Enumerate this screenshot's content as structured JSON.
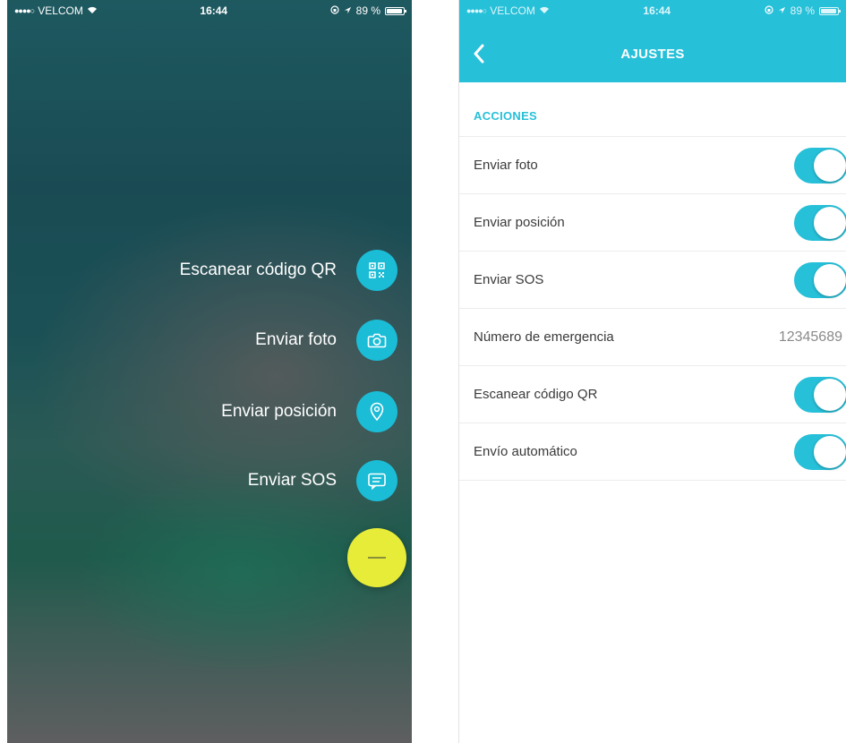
{
  "colors": {
    "accent": "#27c0d9",
    "fab_main": "#e7ec38",
    "fab_item": "#1bbcd6"
  },
  "status_bar": {
    "carrier": "VELCOM",
    "time": "16:44",
    "battery": "89 %"
  },
  "menu": {
    "items": [
      {
        "label": "Escanear código QR",
        "icon": "qr-code-icon"
      },
      {
        "label": "Enviar foto",
        "icon": "camera-icon"
      },
      {
        "label": "Enviar posición",
        "icon": "location-pin-icon"
      },
      {
        "label": "Enviar SOS",
        "icon": "message-icon"
      }
    ],
    "main_button_icon": "minus-icon"
  },
  "settings": {
    "title": "AJUSTES",
    "back_icon": "chevron-left-icon",
    "section": "ACCIONES",
    "rows": [
      {
        "label": "Enviar foto",
        "toggle": true
      },
      {
        "label": "Enviar posición",
        "toggle": true
      },
      {
        "label": "Enviar SOS",
        "toggle": true
      },
      {
        "label": "Número de emergencia",
        "value": "12345689"
      },
      {
        "label": "Escanear código QR",
        "toggle": true
      },
      {
        "label": "Envío automático",
        "toggle": true
      }
    ]
  }
}
